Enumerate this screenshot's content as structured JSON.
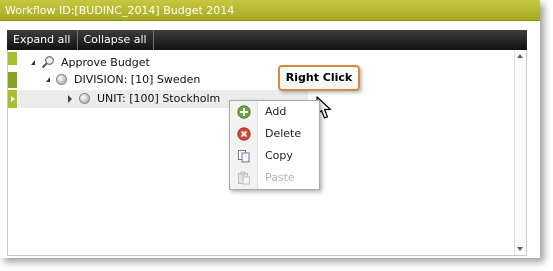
{
  "window": {
    "title": "Workflow ID:[BUDINC_2014] Budget 2014"
  },
  "toolbar": {
    "expand_label": "Expand all",
    "collapse_label": "Collapse all"
  },
  "tree": {
    "root": {
      "label": "Approve Budget",
      "icon": "magnifier-icon"
    },
    "division": {
      "label": "DIVISION: [10] Sweden"
    },
    "unit": {
      "label": "UNIT: [100] Stockholm"
    }
  },
  "context_menu": {
    "items": [
      {
        "label": "Add",
        "icon": "add-icon",
        "enabled": true
      },
      {
        "label": "Delete",
        "icon": "delete-icon",
        "enabled": true
      },
      {
        "label": "Copy",
        "icon": "copy-icon",
        "enabled": true
      },
      {
        "label": "Paste",
        "icon": "paste-icon",
        "enabled": false
      }
    ]
  },
  "callout": {
    "text": "Right Click"
  },
  "colors": {
    "title_bar": "#b8ba31",
    "gutter_green": "#a6bf2d",
    "callout_border": "#d68a3c"
  }
}
